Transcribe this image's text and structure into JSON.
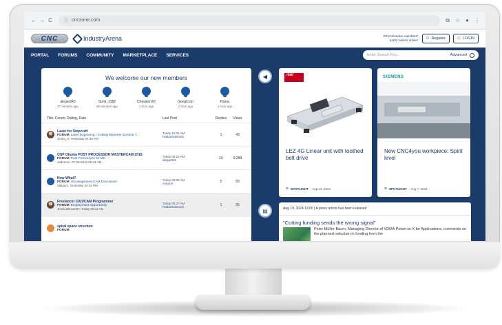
{
  "browser": {
    "url": "cnczone.com",
    "back": "←",
    "forward": "→",
    "reload": "C"
  },
  "header": {
    "cnc_logo": "CNC",
    "arena_logo": "IndustryArena",
    "online_line1": "PRCAM active members*",
    "online_line2": "5,932 visitors online*",
    "register": "Register",
    "login": "LOGIN"
  },
  "nav": {
    "items": [
      "PORTAL",
      "FORUMS",
      "COMMUNITY",
      "MARKETPLACE",
      "SERVICES"
    ],
    "search_placeholder": "Enter Search Key...",
    "advanced": "Advanced"
  },
  "welcome": {
    "title": "We welcome our new members",
    "members": [
      {
        "name": "alegar345",
        "time": "37 minutes ago"
      },
      {
        "name": "Sumi_1382",
        "time": "50 minutes ago"
      },
      {
        "name": "Chavaiorr67",
        "time": "1 hour ago"
      },
      {
        "name": "Googlcom",
        "time": "1 hour ago"
      },
      {
        "name": "Pasus",
        "time": "1 hour ago"
      }
    ]
  },
  "forum": {
    "col_title": "Title, Forum, Rating, Date",
    "col_last": "Last Post",
    "col_replies": "Replies",
    "col_views": "Views",
    "rows": [
      {
        "title": "Laser for Stepcraft",
        "forum_label": "FORUM",
        "forum": "Laser Engraving / Cutting Machine General T...",
        "by": "Jimbo_3, Yesterday 04:50 PM",
        "last_time": "Today 10:05 AM",
        "last_user": "RadarSidetrack",
        "replies": "1",
        "views": "43",
        "avatar": "photo"
      },
      {
        "title": "OSP Okuma POST PROCESSOR MASTERCAM 2018",
        "forum_label": "FORUM",
        "forum": "Post Processors for MC",
        "by": "Jaderson, 07-05-2018 05:34 AM",
        "last_time": "Today 09:52 AM",
        "last_user": "alegar345",
        "replies": "16",
        "views": "9,289",
        "avatar": "blue"
      },
      {
        "title": "Now What?",
        "forum_label": "FORUM",
        "forum": "Uncategorised CAM Discussion",
        "by": "Valguy1, Yesterday 04:44 PM",
        "last_time": "Today 08:33 AM",
        "last_user": "mutarot",
        "replies": "5",
        "views": "93",
        "avatar": "blue"
      },
      {
        "title": "Freelancer CAD/CAM Programmer",
        "forum_label": "FORUM",
        "forum": "Employment Opportunity",
        "by": "JessicaBrown07, Today 05:11 AM",
        "last_time": "Today 08:27 AM",
        "last_user": "RadarSidetrack",
        "replies": "1",
        "views": "25",
        "avatar": "photo"
      },
      {
        "title": "spiral space structure",
        "forum_label": "FORUM",
        "forum": "",
        "by": "",
        "last_time": "",
        "last_user": "",
        "replies": "",
        "views": "",
        "avatar": "orange"
      }
    ]
  },
  "cards": [
    {
      "brand": "isel",
      "title": "LEZ 4G Linear unit with toothed belt drive",
      "spot": "SPOTLIGHT",
      "date": "- Aug 13, 2024"
    },
    {
      "brand": "SIEMENS",
      "title": "New CNC4you workpiece: Spirit level",
      "spot": "SPOTLIGHT",
      "date": "- Aug 7, 2024"
    }
  ],
  "article": {
    "meta": "Aug 19, 2024 13:00 | A press article has been released",
    "headline": "\"Cutting funding sends the wrong signal\"",
    "body": "Peter Müller-Baum, Managing Director of VDMA Power-to-X for Applications, comments on the planned reduction in funding from the"
  },
  "colors": {
    "navy": "#1b3b6b",
    "link": "#1b5aa0",
    "isel_red": "#c8001e",
    "siemens_teal": "#009999"
  }
}
